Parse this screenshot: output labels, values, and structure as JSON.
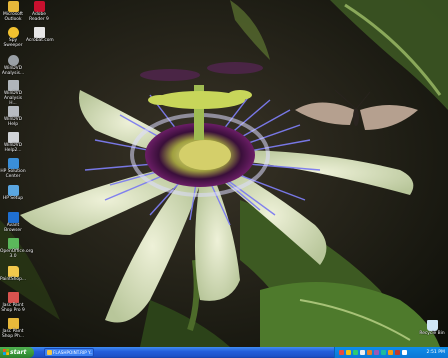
{
  "desktop_icons": [
    {
      "label": "Microsoft Outlook",
      "icon": "outlook-icon",
      "color": "#e8b93a"
    },
    {
      "label": "Adobe Reader 9",
      "icon": "adobe-reader-icon",
      "color": "#c8102e"
    },
    {
      "label": "Spy Sweeper",
      "icon": "spy-sweeper-icon",
      "color": "#f2c230"
    },
    {
      "label": "Acrobat.com",
      "icon": "acrobat-com-icon",
      "color": "#e6e6e6"
    },
    {
      "label": "WinDVD Analysis...",
      "icon": "dvd-icon",
      "color": "#9aa0a6"
    },
    {
      "label": "WinDVD Analysis H...",
      "icon": "dvd-icon",
      "color": "#b0b5ba"
    },
    {
      "label": "WinDVD Help",
      "icon": "dvd-icon",
      "color": "#b8bcc2"
    },
    {
      "label": "WinDVD Help2...",
      "icon": "dvd-icon",
      "color": "#d0d3d6"
    },
    {
      "label": "HP Solution Center",
      "icon": "hp-solution-icon",
      "color": "#3a8fd9"
    },
    {
      "label": "HP Setup",
      "icon": "hp-setup-icon",
      "color": "#5aa6e0"
    },
    {
      "label": "Avant Browser",
      "icon": "avant-browser-icon",
      "color": "#1f6fd1"
    },
    {
      "label": "OpenOffice.org 3.0",
      "icon": "openoffice-icon",
      "color": "#5bb85b"
    },
    {
      "label": "PaintShop...",
      "icon": "folder-icon",
      "color": "#f2c94c"
    },
    {
      "label": "Jasc Paint Shop Pro 9",
      "icon": "paintshop-icon",
      "color": "#d9534f"
    },
    {
      "label": "Jasc Paint Shop Ph...",
      "icon": "paintshop-photo-icon",
      "color": "#e8b93a"
    }
  ],
  "recycle_bin": {
    "label": "Recycle Bin",
    "icon": "recycle-bin-icon",
    "color": "#cfe6f5"
  },
  "taskbar": {
    "start_label": "start",
    "task_button": "FLASHPOINT.RIP Y..."
  },
  "tray": {
    "icons": [
      "shield-icon",
      "network-icon",
      "volume-icon",
      "update-icon",
      "security-icon",
      "antivirus-icon",
      "messenger-icon",
      "printer-icon",
      "power-icon",
      "alert-icon"
    ],
    "colors": [
      "#e74c3c",
      "#f1c40f",
      "#2ecc71",
      "#ecf0f1",
      "#e67e22",
      "#9b59b6",
      "#1abc9c",
      "#f39c12",
      "#c0392b",
      "#ffffff"
    ],
    "clock": "2:51 PM"
  }
}
